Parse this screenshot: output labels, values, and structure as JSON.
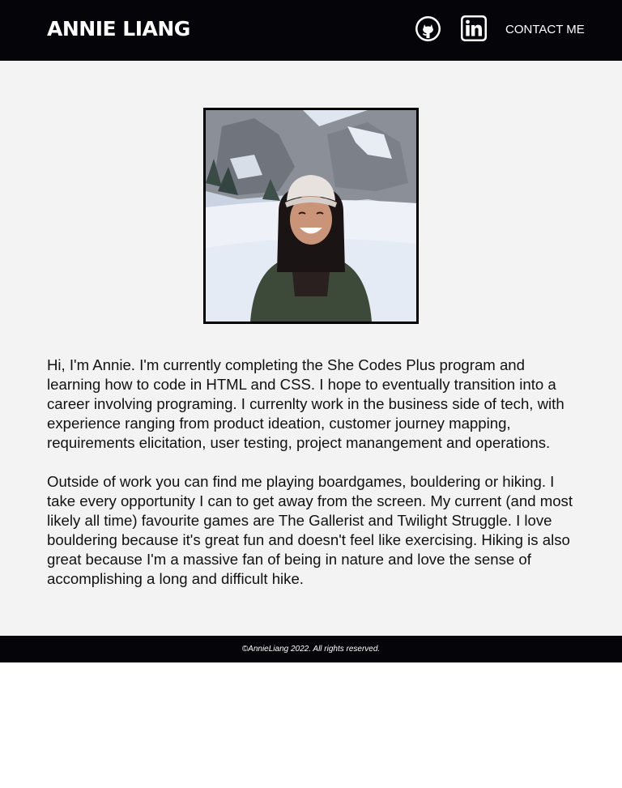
{
  "header": {
    "logo_text": "ANNIE LIANG",
    "github_icon": "github-icon",
    "linkedin_icon": "linkedin-icon",
    "contact_label": "CONTACT ME"
  },
  "profile_photo": {
    "alt": "Profile photo of Annie"
  },
  "bio": {
    "paragraph_1": "Hi, I'm Annie. I'm currently completing the She Codes Plus program and learning how to code in HTML and CSS. I hope to eventually transition into a career involving programing. I currenlty work in the business side of tech, with experience ranging from product ideation, customer journey mapping, requirements elicitation, user testing, project manangement and operations.",
    "paragraph_2": "Outside of work you can find me playing boardgames, bouldering or hiking. I take every opportunity I can to get away from the screen. My current (and most likely all time) favourite games are The Gallerist and Twilight Struggle. I love bouldering because it's great fun and doesn't feel like exercising. Hiking is also great because I'm a massive fan of being in nature and love the sense of accomplishing a long and difficult hike."
  },
  "footer": {
    "copyright": "©AnnieLiang 2022. All rights reserved."
  },
  "colors": {
    "header_bg": "#050509",
    "main_bg": "#f3f3f3",
    "text": "#111111"
  }
}
